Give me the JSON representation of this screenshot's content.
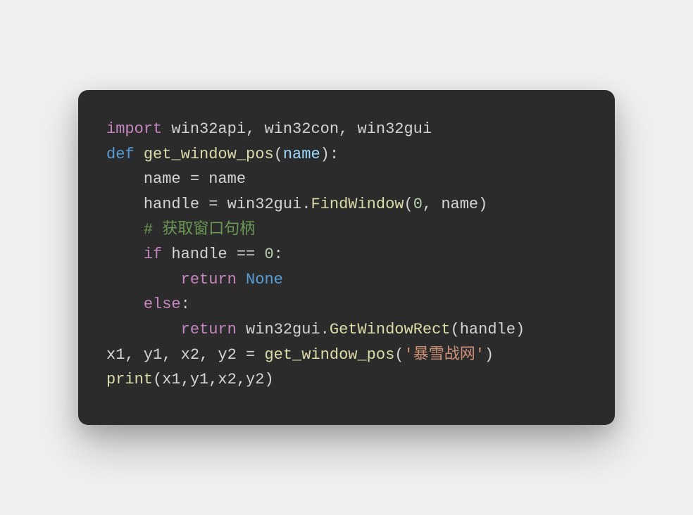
{
  "code": {
    "line1": {
      "import": "import",
      "modules": "win32api, win32con, win32gui"
    },
    "line2": {
      "def": "def",
      "fn": "get_window_pos",
      "open": "(",
      "param": "name",
      "close": "):"
    },
    "line3": {
      "indent": "    ",
      "lhs": "name ",
      "eq": "= ",
      "rhs": "name"
    },
    "line4": {
      "indent": "    ",
      "lhs": "handle ",
      "eq": "= ",
      "mod": "win32gui",
      "dot": ".",
      "fn": "FindWindow",
      "open": "(",
      "arg1": "0",
      "comma": ", ",
      "arg2": "name",
      "close": ")"
    },
    "line5": {
      "indent": "    ",
      "comment": "# 获取窗口句柄"
    },
    "line6": {
      "indent": "    ",
      "if": "if",
      "sp": " ",
      "cond": "handle == ",
      "zero": "0",
      "colon": ":"
    },
    "line7": {
      "indent": "        ",
      "return": "return",
      "sp": " ",
      "none": "None"
    },
    "line8": {
      "indent": "    ",
      "else": "else",
      "colon": ":"
    },
    "line9": {
      "indent": "        ",
      "return": "return",
      "sp": " ",
      "mod": "win32gui",
      "dot": ".",
      "fn": "GetWindowRect",
      "open": "(",
      "arg": "handle",
      "close": ")"
    },
    "line10": {
      "vars": "x1, y1, x2, y2 ",
      "eq": "= ",
      "fn": "get_window_pos",
      "open": "(",
      "str": "'暴雪战网'",
      "close": ")"
    },
    "line11": {
      "fn": "print",
      "open": "(",
      "args": "x1,y1,x2,y2",
      "close": ")"
    }
  }
}
